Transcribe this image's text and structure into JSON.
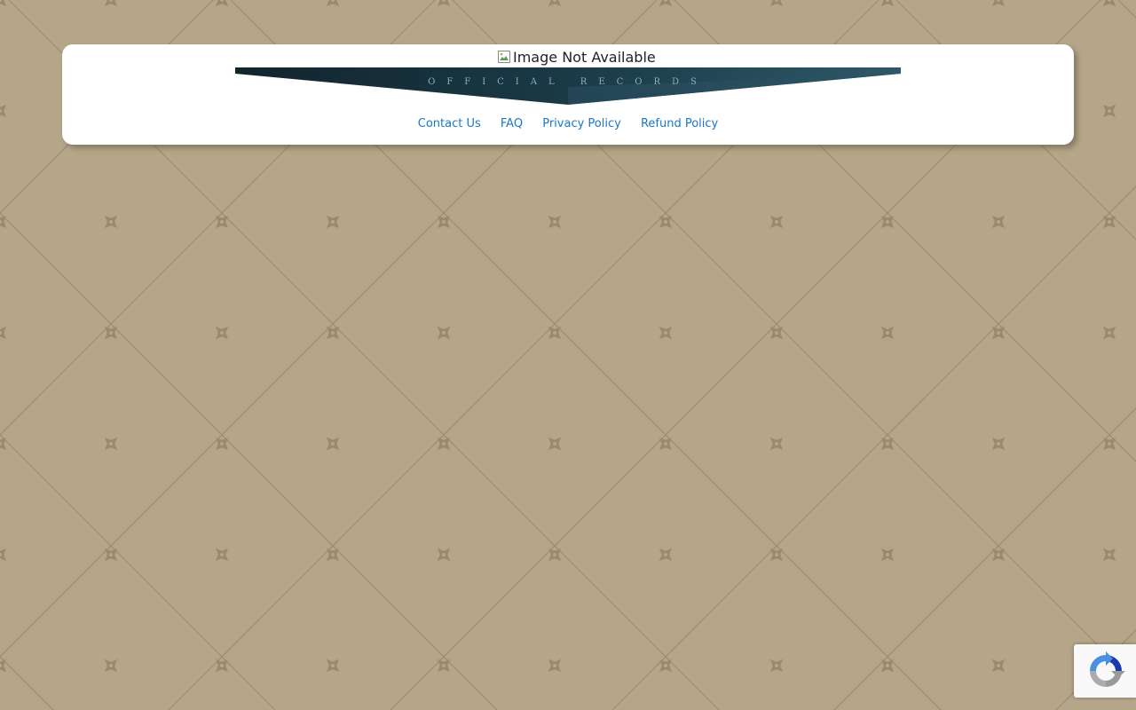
{
  "header": {
    "logo_alt": "Image Not Available",
    "banner_text": "OFFICIAL RECORDS"
  },
  "nav": {
    "links": [
      {
        "label": "Contact Us"
      },
      {
        "label": "FAQ"
      },
      {
        "label": "Privacy Policy"
      },
      {
        "label": "Refund Policy"
      }
    ]
  },
  "colors": {
    "background": "#b5a689",
    "link": "#1a77c9",
    "banner_dark": "#15303a",
    "banner_light": "#2e5566"
  },
  "icons": {
    "broken_image": "broken-image-icon",
    "recaptcha": "recaptcha-icon"
  }
}
